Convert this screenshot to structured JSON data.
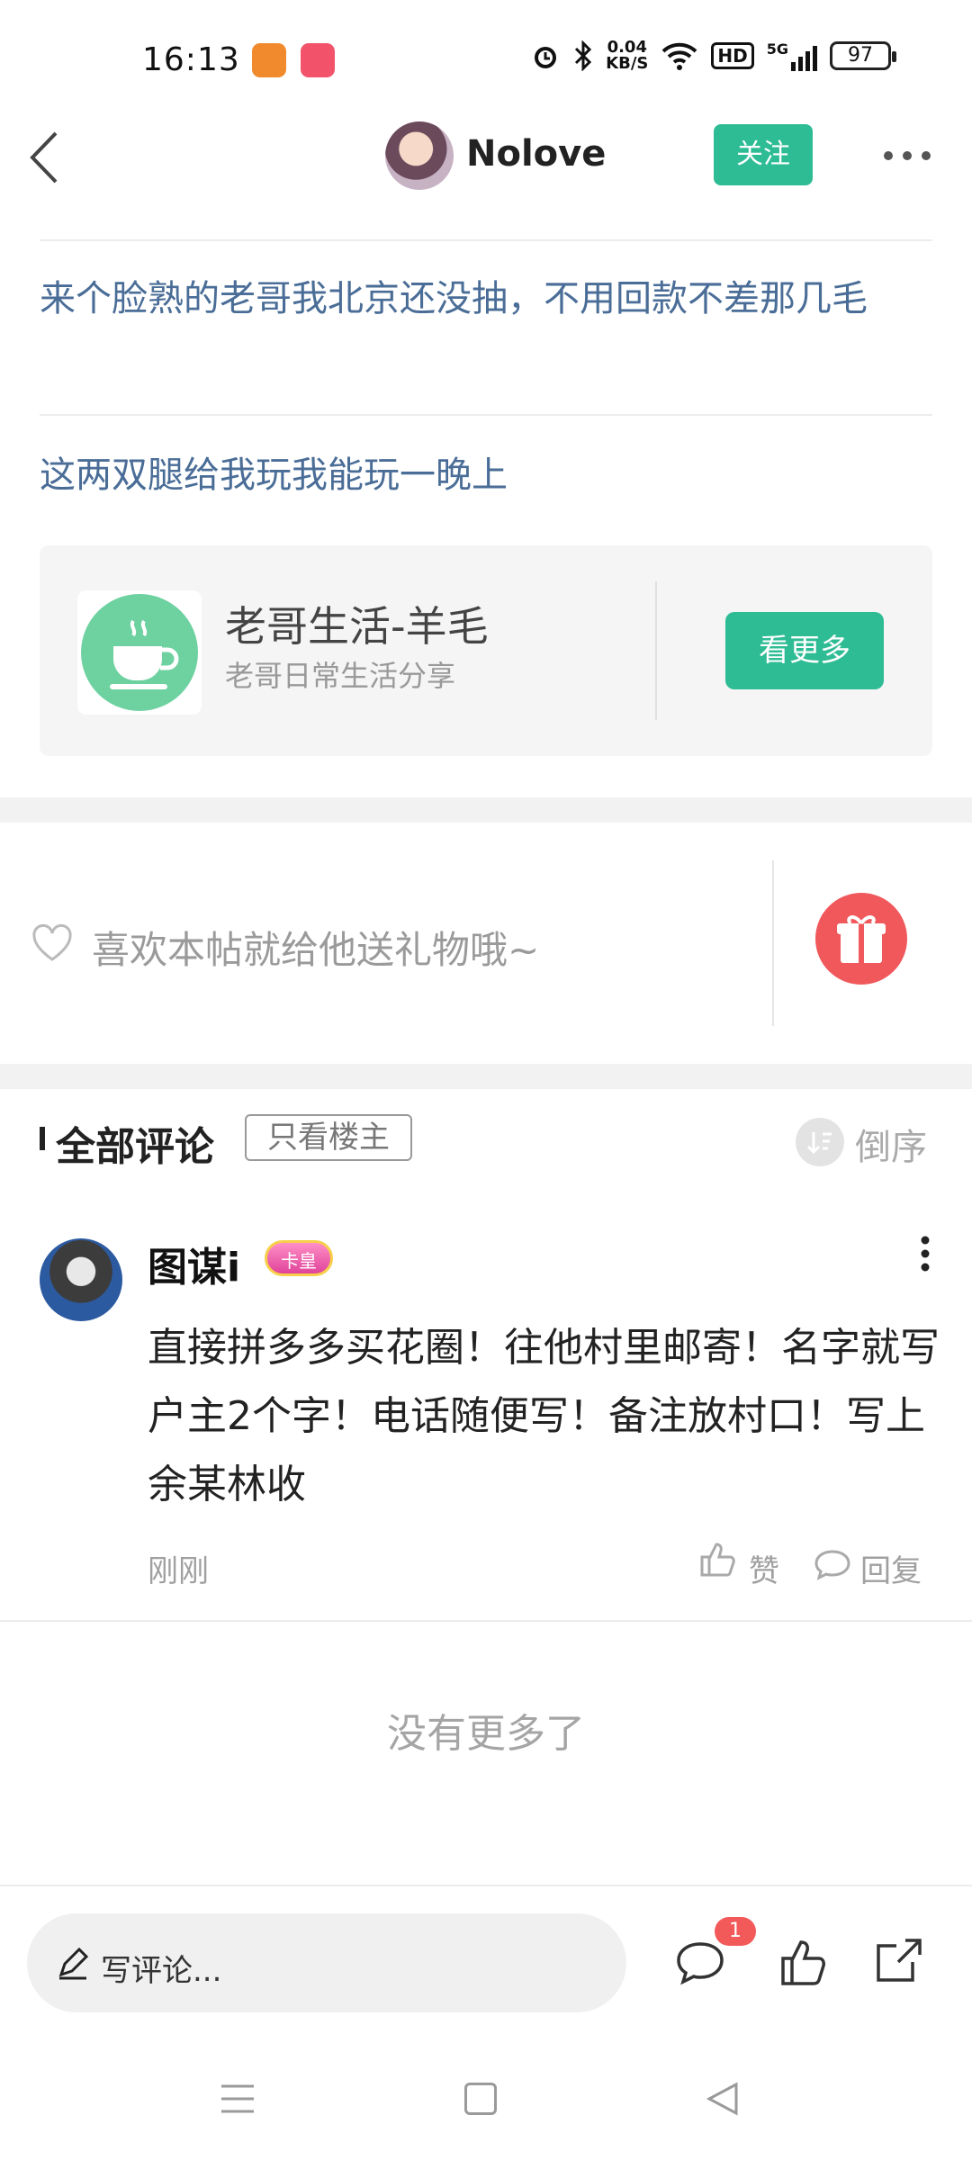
{
  "status_bar": {
    "time": "16:13",
    "net_speed_value": "0.04",
    "net_speed_unit": "KB/S",
    "hd": "HD",
    "network": "5G",
    "battery": "97",
    "icons": [
      "alarm-icon",
      "bluetooth-icon",
      "wifi-icon",
      "signal-icon"
    ]
  },
  "header": {
    "author": "Nolove",
    "follow_label": "关注"
  },
  "post": {
    "line1": "来个脸熟的老哥我北京还没抽，不用回款不差那几毛",
    "line2": "这两双腿给我玩我能玩一晚上"
  },
  "channel": {
    "title": "老哥生活-羊毛",
    "subtitle": "老哥日常生活分享",
    "button": "看更多",
    "icon": "coffee-cup-icon"
  },
  "gift": {
    "prompt": "喜欢本帖就给他送礼物哦~",
    "icon": "gift-icon"
  },
  "comments_header": {
    "title": "全部评论",
    "filter": "只看楼主",
    "sort": "倒序"
  },
  "comments": [
    {
      "user": "图谋i",
      "badge": "卡皇",
      "text": "直接拼多多买花圈！往他村里邮寄！名字就写户主2个字！电话随便写！备注放村口！写上余某林收",
      "time": "刚刚",
      "like_label": "赞",
      "reply_label": "回复"
    }
  ],
  "footer_text": "没有更多了",
  "bottom_bar": {
    "input_placeholder": "写评论...",
    "comment_badge": "1"
  },
  "colors": {
    "accent": "#2ebc94",
    "link": "#4a6d97",
    "gift": "#f0585c",
    "badge": "#f25a5a"
  }
}
